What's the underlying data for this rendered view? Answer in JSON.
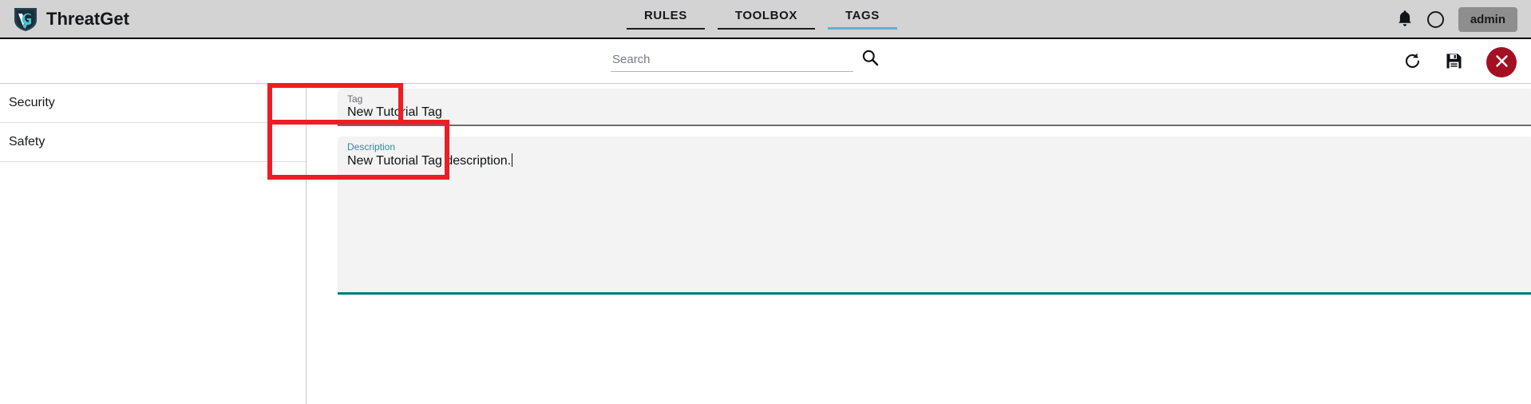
{
  "app": {
    "brand_name": "ThreatGet",
    "logo_icon": "shield-logo-icon"
  },
  "nav": {
    "tabs": [
      {
        "label": "RULES",
        "active": false
      },
      {
        "label": "TOOLBOX",
        "active": false
      },
      {
        "label": "TAGS",
        "active": true
      }
    ],
    "notification_icon": "bell-icon",
    "avatar_icon": "circle-avatar-icon",
    "user_label": "admin"
  },
  "toolbar": {
    "search_value": "",
    "search_placeholder": "Search",
    "search_icon": "magnifier-icon",
    "refresh_icon": "reload-icon",
    "save_icon": "floppy-disk-save-icon",
    "close_icon": "close-x-icon"
  },
  "sidebar": {
    "items": [
      {
        "label": "Security"
      },
      {
        "label": "Safety"
      }
    ]
  },
  "form": {
    "tag": {
      "label": "Tag",
      "value": "New Tutorial Tag",
      "focused": false
    },
    "description": {
      "label": "Description",
      "value": "New Tutorial Tag description.",
      "focused": true
    }
  },
  "colors": {
    "appbar_bg": "#d3d3d3",
    "accent_teal": "#00797f",
    "tab_underline_active": "#55b8c7",
    "close_red": "#a31021",
    "annotation_red": "#ee1c25",
    "field_bg": "#f3f3f3",
    "admin_btn_bg": "#8e8e8e"
  }
}
